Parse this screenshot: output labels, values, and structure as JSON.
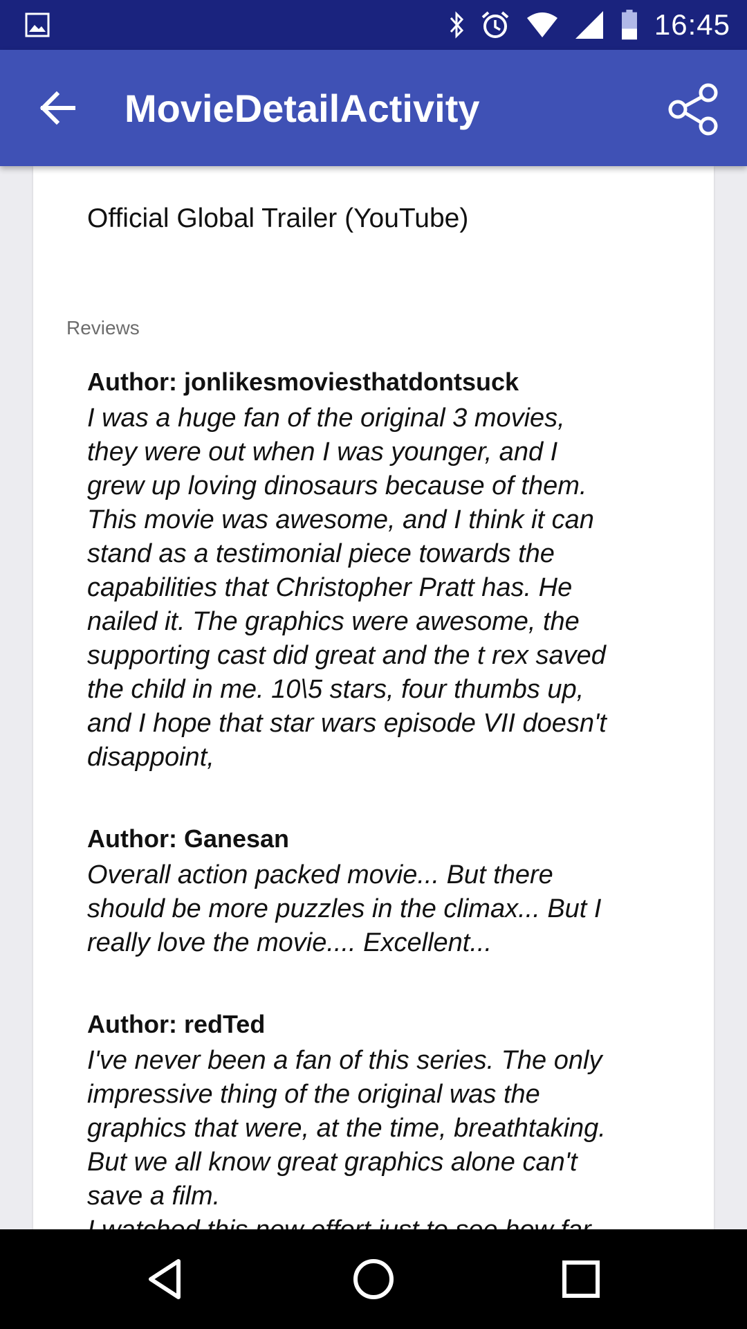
{
  "status_bar": {
    "time": "16:45",
    "icons": [
      "gallery-icon",
      "bluetooth-icon",
      "alarm-icon",
      "wifi-icon",
      "cellular-signal-icon",
      "battery-icon"
    ]
  },
  "app_bar": {
    "title": "MovieDetailActivity",
    "back_icon": "arrow-back-icon",
    "share_icon": "share-icon"
  },
  "trailer": {
    "label": "Official Global Trailer (YouTube)"
  },
  "reviews": {
    "header": "Reviews",
    "items": [
      {
        "author": "Author: jonlikesmoviesthatdontsuck",
        "lines": [
          "I was a huge fan of the original 3 movies,",
          "they were out when I was younger, and I",
          "grew up loving dinosaurs because of them.",
          "This movie was awesome, and I think it can",
          "stand as a testimonial piece towards the",
          "capabilities that Christopher Pratt has. He",
          "nailed it. The graphics were awesome, the",
          "supporting cast did great and the t rex saved",
          "the child in me. 10\\5 stars, four thumbs up,",
          "and I hope that star wars episode VII doesn't",
          "disappoint,"
        ]
      },
      {
        "author": "Author: Ganesan",
        "lines": [
          "Overall action packed movie... But there",
          "should be more puzzles in the climax... But I",
          "really love the movie.... Excellent..."
        ]
      },
      {
        "author": "Author: redTed",
        "lines": [
          "I've never been a fan of this series. The only",
          "impressive thing of the original was the",
          "graphics that were, at the time, breathtaking.",
          "But we all know great graphics alone can't",
          "save a film.",
          "I watched this new effort just to see how far"
        ]
      }
    ]
  },
  "nav_bar": {
    "icons": [
      "back-triangle-icon",
      "home-circle-icon",
      "recents-square-icon"
    ]
  }
}
